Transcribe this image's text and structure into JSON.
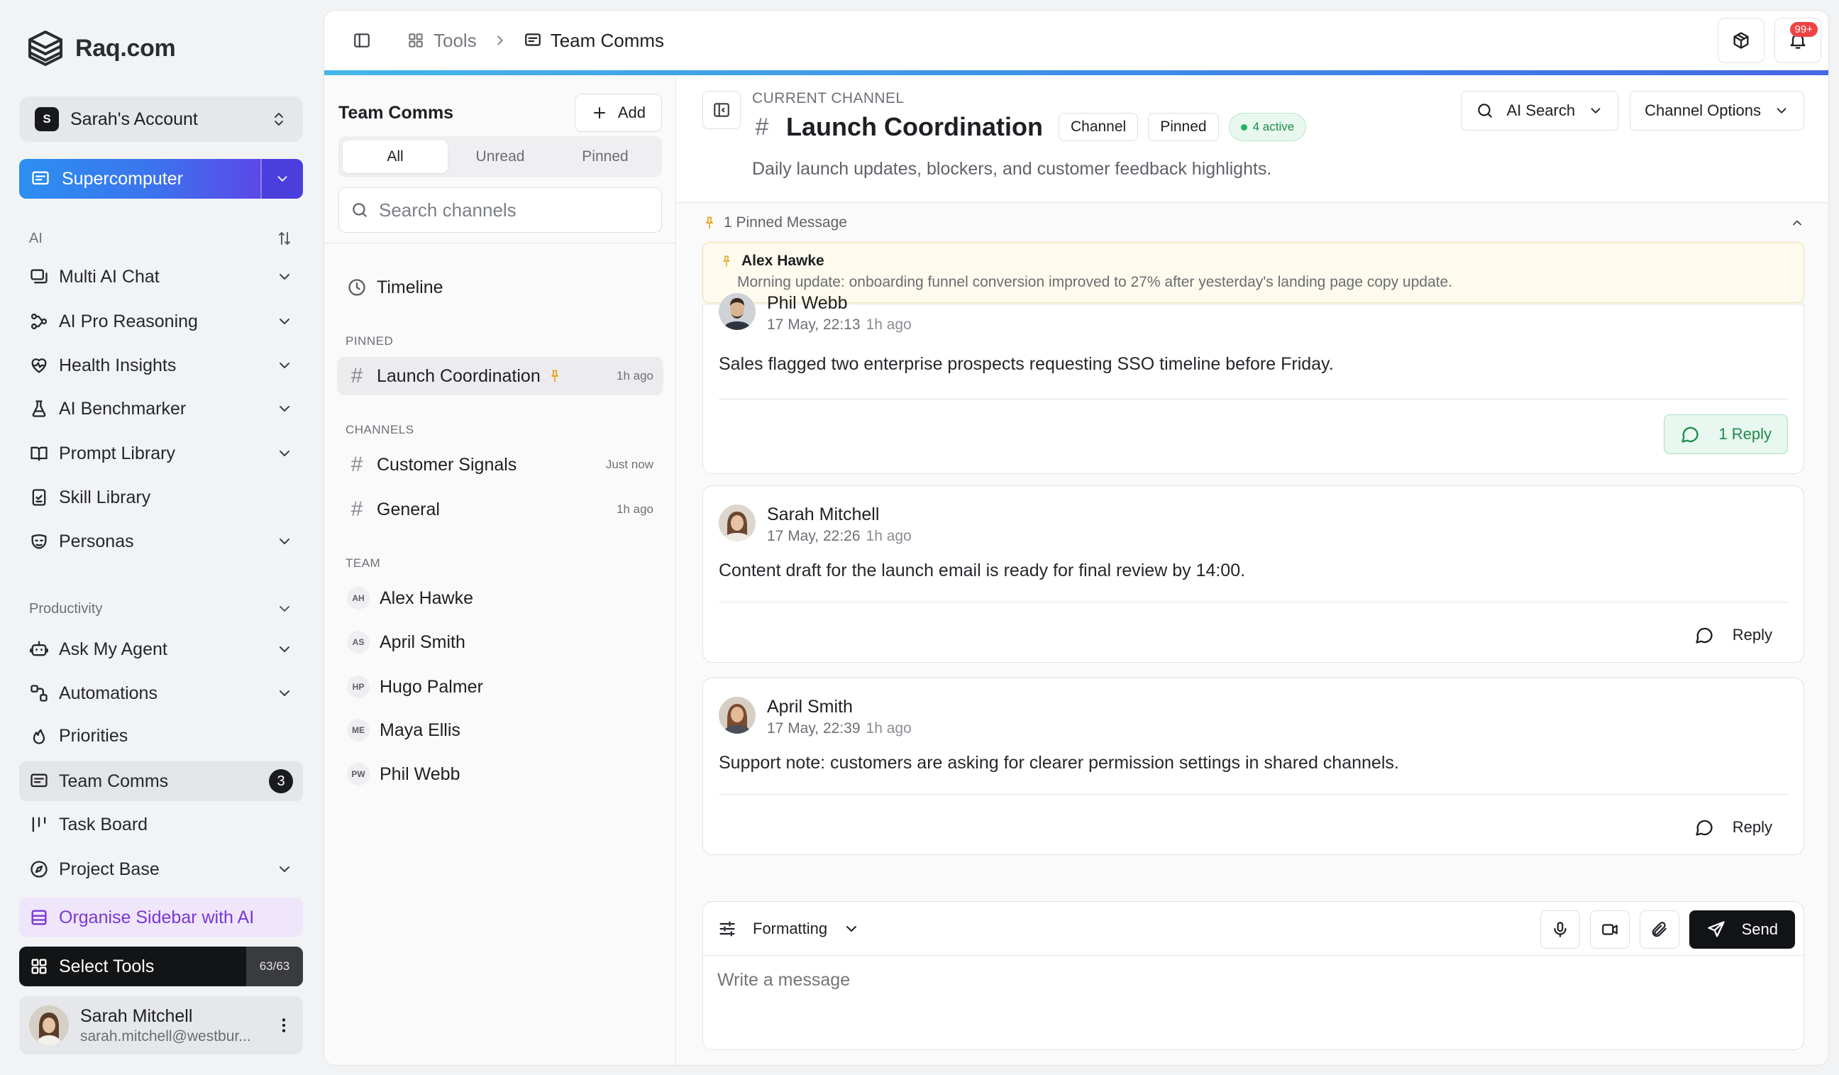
{
  "brand": {
    "name": "Raq.com"
  },
  "account": {
    "initial": "S",
    "name": "Sarah's Account"
  },
  "supercomputer": {
    "label": "Supercomputer"
  },
  "sections": {
    "ai": "AI",
    "productivity": "Productivity"
  },
  "ai_items": [
    {
      "label": "Multi AI Chat",
      "icon": "chat-stack-icon",
      "expandable": true
    },
    {
      "label": "AI Pro Reasoning",
      "icon": "nodes-icon",
      "expandable": true
    },
    {
      "label": "Health Insights",
      "icon": "heart-pulse-icon",
      "expandable": true
    },
    {
      "label": "AI Benchmarker",
      "icon": "flask-icon",
      "expandable": true
    },
    {
      "label": "Prompt Library",
      "icon": "book-icon",
      "expandable": true
    },
    {
      "label": "Skill Library",
      "icon": "clipboard-icon",
      "expandable": false
    },
    {
      "label": "Personas",
      "icon": "mask-icon",
      "expandable": true
    }
  ],
  "productivity_items": [
    {
      "label": "Ask My Agent",
      "icon": "robot-icon",
      "expandable": true
    },
    {
      "label": "Automations",
      "icon": "workflow-icon",
      "expandable": true
    },
    {
      "label": "Priorities",
      "icon": "flame-icon",
      "expandable": false
    },
    {
      "label": "Team Comms",
      "icon": "message-square-icon",
      "badge": "3",
      "active": true
    },
    {
      "label": "Task Board",
      "icon": "kanban-icon",
      "expandable": false
    },
    {
      "label": "Project Base",
      "icon": "compass-icon",
      "expandable": true
    }
  ],
  "organise": {
    "label": "Organise Sidebar with AI"
  },
  "select_tools": {
    "label": "Select Tools",
    "count": "63/63"
  },
  "user": {
    "name": "Sarah Mitchell",
    "email": "sarah.mitchell@westbur..."
  },
  "breadcrumb": {
    "root": "Tools",
    "current": "Team Comms"
  },
  "notifications": {
    "badge": "99+"
  },
  "channel_list": {
    "title": "Team Comms",
    "add_label": "Add",
    "filters": [
      "All",
      "Unread",
      "Pinned"
    ],
    "active_filter": "All",
    "search_placeholder": "Search channels",
    "timeline_label": "Timeline",
    "pinned_label": "PINNED",
    "pinned": [
      {
        "name": "Launch Coordination",
        "time": "1h ago"
      }
    ],
    "channels_label": "CHANNELS",
    "channels": [
      {
        "name": "Customer Signals",
        "time": "Just now"
      },
      {
        "name": "General",
        "time": "1h ago"
      }
    ],
    "team_label": "TEAM",
    "team": [
      {
        "initials": "AH",
        "name": "Alex Hawke"
      },
      {
        "initials": "AS",
        "name": "April Smith"
      },
      {
        "initials": "HP",
        "name": "Hugo Palmer"
      },
      {
        "initials": "ME",
        "name": "Maya Ellis"
      },
      {
        "initials": "PW",
        "name": "Phil Webb"
      }
    ]
  },
  "channel": {
    "current_label": "CURRENT CHANNEL",
    "title": "Launch Coordination",
    "tag_channel": "Channel",
    "tag_pinned": "Pinned",
    "active": "4 active",
    "description": "Daily launch updates, blockers, and customer feedback highlights.",
    "ai_search": "AI Search",
    "options": "Channel Options"
  },
  "pinned_message": {
    "bar_label": "1 Pinned Message",
    "author": "Alex Hawke",
    "text": "Morning update: onboarding funnel conversion improved to 27% after yesterday's landing page copy update."
  },
  "messages": [
    {
      "author": "Phil Webb",
      "date": "17 May, 22:13",
      "ago": "1h ago",
      "text": "Sales flagged two enterprise prospects requesting SSO timeline before Friday.",
      "reply": "1 Reply",
      "has_replies": true
    },
    {
      "author": "Sarah Mitchell",
      "date": "17 May, 22:26",
      "ago": "1h ago",
      "text": "Content draft for the launch email is ready for final review by 14:00.",
      "reply": "Reply",
      "has_replies": false
    },
    {
      "author": "April Smith",
      "date": "17 May, 22:39",
      "ago": "1h ago",
      "text": "Support note: customers are asking for clearer permission settings in shared channels.",
      "reply": "Reply",
      "has_replies": false
    }
  ],
  "composer": {
    "formatting": "Formatting",
    "placeholder": "Write a message",
    "send": "Send"
  },
  "colors": {
    "accent_gradient": [
      "#2c8ff0",
      "#5b48e8"
    ],
    "organise_bg": "#efe6fb",
    "organise_text": "#7a36d6",
    "active_green": "#1f8a4c",
    "notif_red": "#ef4444",
    "pinned_bg": "#fefaed"
  }
}
